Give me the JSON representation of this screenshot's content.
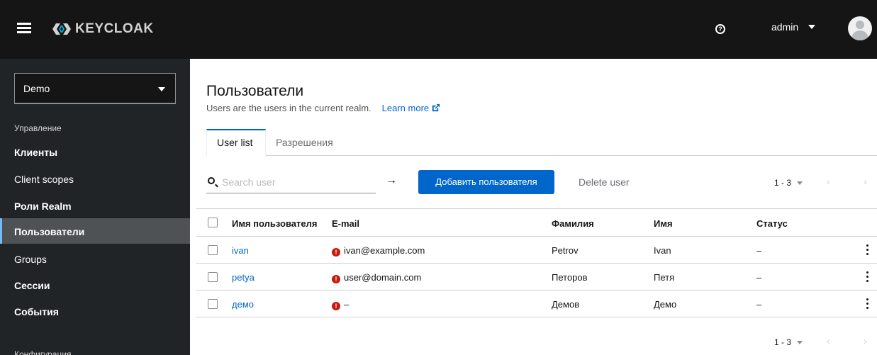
{
  "masthead": {
    "brand": "KEYCLOAK",
    "user": "admin"
  },
  "sidebar": {
    "realm": "Demo",
    "section_manage": "Управление",
    "items": [
      {
        "label": "Клиенты"
      },
      {
        "label": "Client scopes"
      },
      {
        "label": "Роли Realm"
      },
      {
        "label": "Пользователи"
      },
      {
        "label": "Groups"
      },
      {
        "label": "Сессии"
      },
      {
        "label": "События"
      }
    ],
    "section_configure": "Конфигурация"
  },
  "page": {
    "title": "Пользователи",
    "description": "Users are the users in the current realm.",
    "learn_more": "Learn more"
  },
  "tabs": [
    {
      "label": "User list",
      "active": true
    },
    {
      "label": "Разрешения",
      "active": false
    }
  ],
  "toolbar": {
    "search_placeholder": "Search user",
    "add_label": "Добавить пользователя",
    "delete_label": "Delete user",
    "pagination": "1 - 3"
  },
  "table": {
    "columns": [
      "Имя пользователя",
      "E-mail",
      "Фамилия",
      "Имя",
      "Статус"
    ],
    "rows": [
      {
        "username": "ivan",
        "email": "ivan@example.com",
        "last_name": "Petrov",
        "first_name": "Ivan",
        "status": "–"
      },
      {
        "username": "petya",
        "email": "user@domain.com",
        "last_name": "Петоров",
        "first_name": "Петя",
        "status": "–"
      },
      {
        "username": "демо",
        "email": "–",
        "last_name": "Демов",
        "first_name": "Демо",
        "status": "–"
      }
    ]
  },
  "colors": {
    "masthead_bg": "#151515",
    "sidebar_bg": "#212427",
    "primary": "#0066cc",
    "error": "#c9190b"
  }
}
